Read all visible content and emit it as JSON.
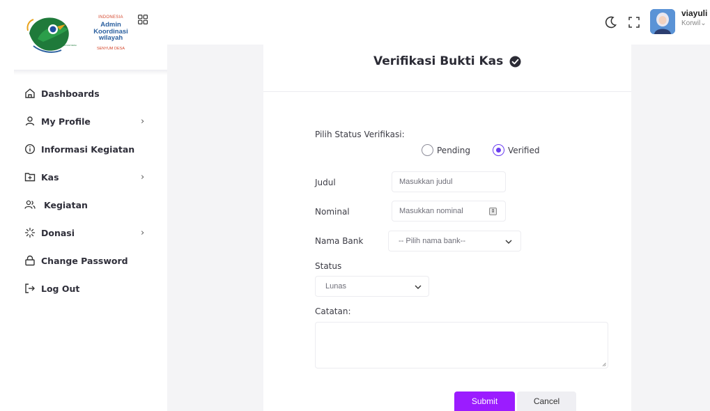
{
  "logo": {
    "line1": "INDONESIA",
    "line2": "Admin",
    "line3": "Koordinasi",
    "line4": "wilayah",
    "line5": "SENYUM DESA"
  },
  "sidebar": {
    "items": [
      {
        "label": "Dashboards",
        "icon": "home-icon",
        "has_submenu": false
      },
      {
        "label": "My Profile",
        "icon": "user-icon",
        "has_submenu": true
      },
      {
        "label": "Informasi Kegiatan",
        "icon": "info-icon",
        "has_submenu": false
      },
      {
        "label": "Kas",
        "icon": "folder-plus-icon",
        "has_submenu": true
      },
      {
        "label": "Kegiatan",
        "icon": "users-icon",
        "has_submenu": false
      },
      {
        "label": "Donasi",
        "icon": "loader-icon",
        "has_submenu": true
      },
      {
        "label": "Change Password",
        "icon": "lock-icon",
        "has_submenu": false
      },
      {
        "label": "Log Out",
        "icon": "logout-icon",
        "has_submenu": false
      }
    ],
    "chevron": "›"
  },
  "topbar": {
    "user_name": "viayuli",
    "user_role": "Korwil",
    "role_chevron": "⌄"
  },
  "form": {
    "title": "Verifikasi Bukti Kas",
    "status_label": "Pilih Status Verifikasi:",
    "radio_options": [
      {
        "label": "Pending",
        "checked": false
      },
      {
        "label": "Verified",
        "checked": true
      }
    ],
    "judul_label": "Judul",
    "judul_placeholder": "Masukkan judul",
    "nominal_label": "Nominal",
    "nominal_placeholder": "Masukkan nominal",
    "bank_label": "Nama Bank",
    "bank_selected": "-- Pilih nama bank--",
    "status_field_label": "Status",
    "status_selected": "Lunas",
    "catatan_label": "Catatan:",
    "submit_label": "Submit",
    "cancel_label": "Cancel"
  },
  "colors": {
    "accent": "#9b1cff",
    "radio_active": "#6a3df0",
    "background": "#f4f4f6"
  }
}
